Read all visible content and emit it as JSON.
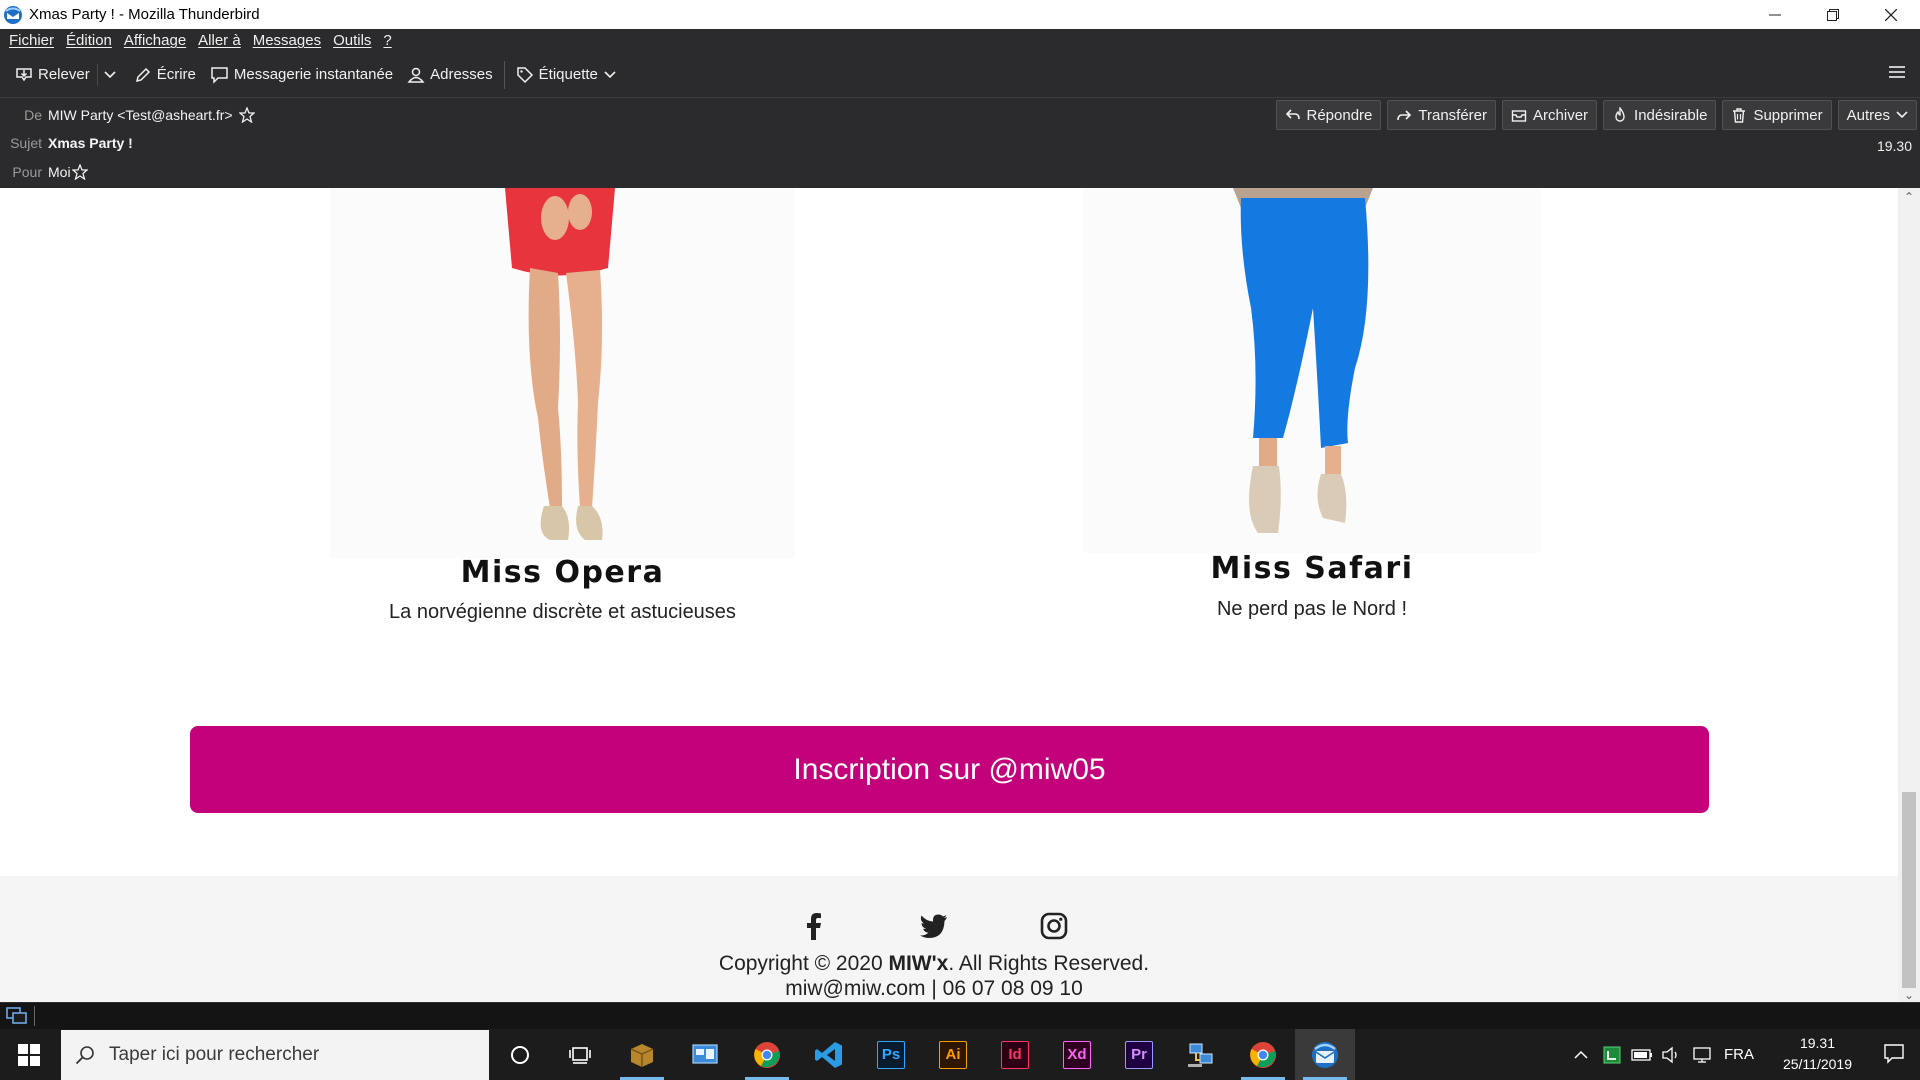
{
  "window": {
    "title": "Xmas Party ! - Mozilla Thunderbird",
    "controls": [
      "minimize",
      "restore",
      "close"
    ]
  },
  "menubar": {
    "items": [
      "Fichier",
      "Édition",
      "Affichage",
      "Aller à",
      "Messages",
      "Outils",
      "?"
    ]
  },
  "toolbar": {
    "get_mail": "Relever",
    "write": "Écrire",
    "chat": "Messagerie instantanée",
    "address_book": "Adresses",
    "tag": "Étiquette"
  },
  "header": {
    "from_label": "De",
    "from_value": "MIW Party <Test@asheart.fr>",
    "subject_label": "Sujet",
    "subject_value": "Xmas Party !",
    "to_label": "Pour",
    "to_value": "Moi",
    "time": "19.30",
    "buttons": {
      "reply": "Répondre",
      "forward": "Transférer",
      "archive": "Archiver",
      "junk": "Indésirable",
      "delete": "Supprimer",
      "other": "Autres"
    }
  },
  "message": {
    "models": [
      {
        "name": "Miss Opera",
        "tagline": "La norvégienne discrète et astucieuses",
        "outfit_color": "#e8343c"
      },
      {
        "name": "Miss Safari",
        "tagline": "Ne perd pas le Nord !",
        "outfit_color": "#1479e0"
      }
    ],
    "cta_label": "Inscription sur @miw05",
    "cta_color": "#c2017a",
    "footer": {
      "socials": [
        "facebook-icon",
        "twitter-icon",
        "instagram-icon"
      ],
      "copyright_prefix": "Copyright © 2020 ",
      "copyright_brand": "MIW'x",
      "copyright_suffix": ". All Rights Reserved.",
      "contact": "miw@miw.com | 06 07 08 09 10"
    }
  },
  "taskbar": {
    "search_placeholder": "Taper ici pour rechercher",
    "apps": [
      "cortana",
      "task-view",
      "package",
      "control-panel",
      "chrome",
      "vscode",
      "Ps",
      "Ai",
      "Id",
      "Xd",
      "Pr",
      "network",
      "chrome",
      "thunderbird"
    ],
    "tray_language": "FRA",
    "clock_time": "19.31",
    "clock_date": "25/11/2019"
  }
}
